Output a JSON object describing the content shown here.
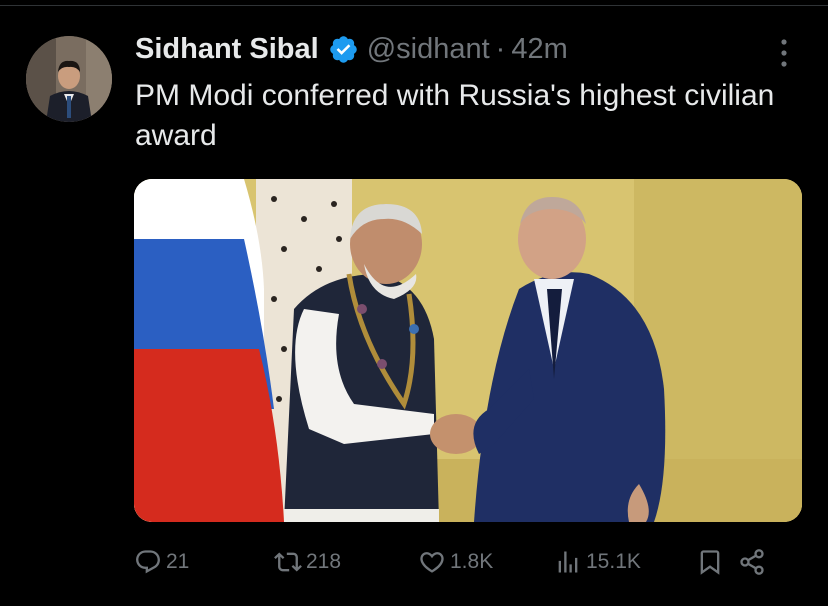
{
  "tweet": {
    "author_name": "Sidhant Sibal",
    "handle": "@sidhant",
    "separator": "·",
    "time": "42m",
    "text": "PM Modi conferred with Russia's highest civilian award"
  },
  "actions": {
    "replies": "21",
    "reposts": "218",
    "likes": "1.8K",
    "views": "15.1K"
  },
  "icons": [
    "avatar",
    "verified-badge-icon",
    "more-options-icon",
    "reply-icon",
    "repost-icon",
    "like-icon",
    "views-icon",
    "bookmark-icon",
    "share-icon"
  ],
  "colors": {
    "background": "#000000",
    "text": "#e7e9ea",
    "muted": "#71767b",
    "verified": "#1d9bf0"
  }
}
